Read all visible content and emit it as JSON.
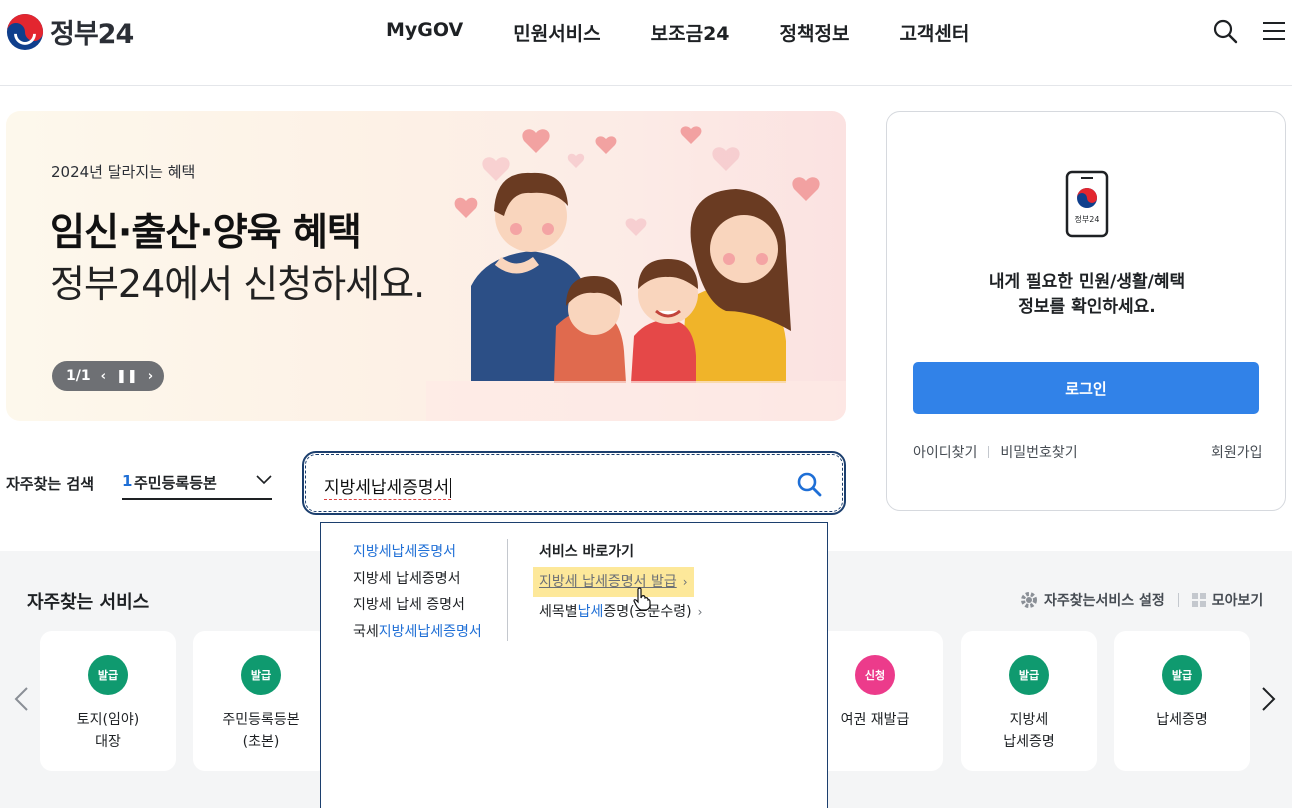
{
  "header": {
    "logo_text": "정부24",
    "nav": [
      "MyGOV",
      "민원서비스",
      "보조금24",
      "정책정보",
      "고객센터"
    ],
    "icons": [
      "search-icon",
      "hamburger-menu-icon"
    ]
  },
  "banner": {
    "subtitle": "2024년 달라지는 혜택",
    "title_line1": "임신·출산·양육 혜택",
    "title_line2": "정부24에서 신청하세요.",
    "pager": "1/1"
  },
  "login": {
    "app_label": "정부24",
    "message_line1": "내게 필요한 민원/생활/혜택",
    "message_line2": "정보를 확인하세요.",
    "login_button": "로그인",
    "find_id": "아이디찾기",
    "find_password": "비밀번호찾기",
    "join": "회원가입"
  },
  "search": {
    "fav_label": "자주찾는 검색",
    "fav_rank": "1",
    "fav_value": "주민등록등본",
    "query": "지방세납세증명서"
  },
  "autocomplete": {
    "suggestions": [
      {
        "pre": "",
        "hl": "지방세납세증명서",
        "post": ""
      },
      {
        "pre": "지방세 납세증명서",
        "hl": "",
        "post": ""
      },
      {
        "pre": "지방세 납세 증명서",
        "hl": "",
        "post": ""
      },
      {
        "pre": "국세",
        "hl": "지방세납세증명서",
        "post": ""
      }
    ],
    "shortcut_title": "서비스 바로가기",
    "shortcuts": [
      {
        "pre": "지방세 납세증명서 발급",
        "hl": "",
        "post": ""
      },
      {
        "pre": "세목별",
        "hl": "납세",
        "post": "증명(공문수령)"
      }
    ]
  },
  "services": {
    "title": "자주찾는 서비스",
    "settings": "자주찾는서비스 설정",
    "view_all": "모아보기",
    "cards": [
      {
        "badge": "발급",
        "label": "토지(임야)\n대장",
        "color": "green"
      },
      {
        "badge": "발급",
        "label": "주민등록등본\n(초본)",
        "color": "green"
      },
      {
        "badge": "신청",
        "label": "여권 재발급",
        "color": "pink"
      },
      {
        "badge": "발급",
        "label": "지방세\n납세증명",
        "color": "green"
      },
      {
        "badge": "발급",
        "label": "납세증명",
        "color": "green"
      }
    ]
  },
  "colors": {
    "primary": "#3182e8",
    "highlight": "#1f6fd6",
    "green_badge": "#0f9a6f",
    "pink_badge": "#ec3b8b",
    "dropdown_hover": "#fde89a"
  }
}
